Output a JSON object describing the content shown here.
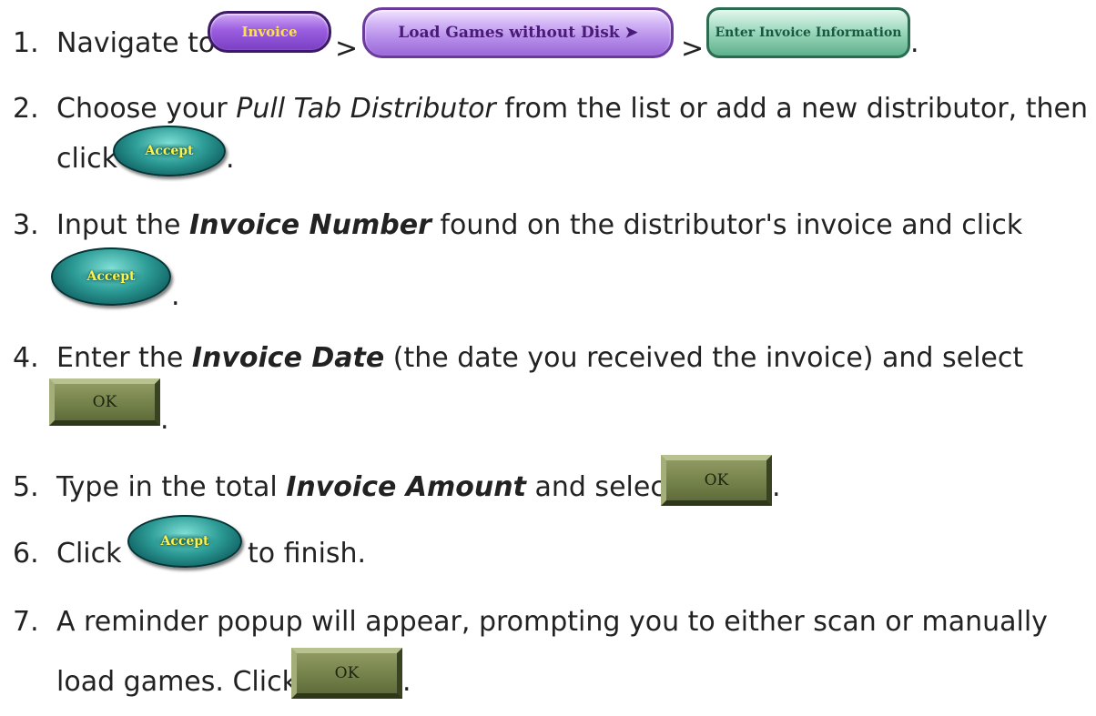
{
  "steps": [
    {
      "number": "1.",
      "prefix": "Navigate to",
      "separator": ">",
      "buttons": [
        "Invoice",
        "Load Games without Disk ➤",
        "Enter Invoice Information"
      ],
      "end": "."
    },
    {
      "number": "2.",
      "line1_a": "Choose your ",
      "line1_italic": "Pull Tab Distributor",
      "line1_b": " from the list or add a new distributor, then",
      "line2": "click",
      "button": "Accept",
      "end": "."
    },
    {
      "number": "3.",
      "a": "Input the ",
      "bold": "Invoice Number",
      "b": " found on the distributor's invoice and click",
      "button": "Accept",
      "end": "."
    },
    {
      "number": "4.",
      "a": "Enter the ",
      "bold": "Invoice Date",
      "b": " (the date you received the invoice) and select",
      "button": "OK",
      "end": "."
    },
    {
      "number": "5.",
      "a": "Type in the total ",
      "bold": "Invoice Amount",
      "b": " and select",
      "button": "OK",
      "end": "."
    },
    {
      "number": "6.",
      "a": "Click",
      "button": "Accept",
      "b": "to finish."
    },
    {
      "number": "7.",
      "line1": "A reminder popup will appear, prompting you to either scan or manually",
      "line2": "load games. Click",
      "button": "OK",
      "end": "."
    }
  ]
}
